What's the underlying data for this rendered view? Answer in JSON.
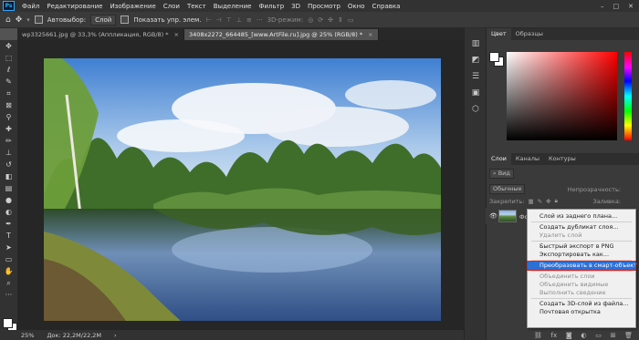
{
  "app": {
    "logo": "Ps"
  },
  "menu": [
    "Файл",
    "Редактирование",
    "Изображение",
    "Слои",
    "Текст",
    "Выделение",
    "Фильтр",
    "3D",
    "Просмотр",
    "Окно",
    "Справка"
  ],
  "window_controls": [
    "–",
    "□",
    "✕"
  ],
  "options_bar": {
    "autoselect_label": "Автовыбор:",
    "autoselect_target": "Слой",
    "show_transform_label": "Показать упр. элем.",
    "mode_3d_label": "3D-режим:"
  },
  "tabs": [
    {
      "label": "wp3325661.jpg @ 33,3% (Аппликация, RGB/8) *",
      "close": "×"
    },
    {
      "label": "3408x2272_664485_[www.ArtFile.ru].jpg @ 25% (RGB/8) *",
      "close": "×"
    }
  ],
  "status": {
    "zoom": "25%",
    "doc": "Док: 22,2M/22,2M"
  },
  "color_panel": {
    "tabs": [
      "Цвет",
      "Образцы"
    ],
    "fg_color": "#ffffff",
    "bg_color": "#ffffff",
    "hue_color": "#ff0000"
  },
  "layers_panel": {
    "tabs": [
      "Слои",
      "Каналы",
      "Контуры"
    ],
    "filter_label": "Вид",
    "blend_mode": "Обычные",
    "opacity_label": "Непрозрачность:",
    "lock_label": "Закрепить:",
    "fill_label": "Заливка:",
    "layer_name": "Фо..."
  },
  "context_menu": {
    "items": [
      {
        "label": "Слой из заднего плана...",
        "disabled": false,
        "highlighted": false
      },
      {
        "separator": true
      },
      {
        "label": "Создать дубликат слоя...",
        "disabled": false,
        "highlighted": false
      },
      {
        "label": "Удалить слой",
        "disabled": true,
        "highlighted": false
      },
      {
        "separator": true
      },
      {
        "label": "Быстрый экспорт в PNG",
        "disabled": false,
        "highlighted": false
      },
      {
        "label": "Экспортировать как...",
        "disabled": false,
        "highlighted": false
      },
      {
        "separator": true
      },
      {
        "label": "Преобразовать в смарт-объект",
        "disabled": false,
        "highlighted": true
      },
      {
        "separator": true
      },
      {
        "label": "Объединить слои",
        "disabled": true,
        "highlighted": false
      },
      {
        "label": "Объединить видимые",
        "disabled": true,
        "highlighted": false
      },
      {
        "label": "Выполнить сведение",
        "disabled": true,
        "highlighted": false
      },
      {
        "separator": true
      },
      {
        "label": "Создать 3D-слой из файла...",
        "disabled": false,
        "highlighted": false
      },
      {
        "label": "Почтовая открытка",
        "disabled": false,
        "highlighted": false
      }
    ]
  },
  "tool_icons": [
    "move-icon",
    "marquee-icon",
    "lasso-icon",
    "quick-select-icon",
    "crop-icon",
    "frame-icon",
    "eyedropper-icon",
    "healing-icon",
    "brush-icon",
    "stamp-icon",
    "history-brush-icon",
    "eraser-icon",
    "gradient-icon",
    "blur-icon",
    "dodge-icon",
    "pen-icon",
    "type-icon",
    "path-select-icon",
    "shape-icon",
    "hand-icon",
    "zoom-icon",
    "more-tools-icon"
  ]
}
